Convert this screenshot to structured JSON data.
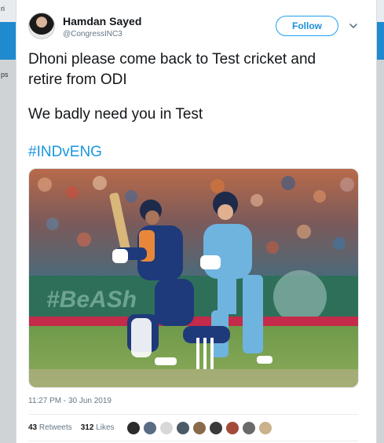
{
  "background": {
    "fragments": [
      "ri",
      "ps"
    ]
  },
  "tweet": {
    "author": {
      "display_name": "Hamdan Sayed",
      "handle": "@CongressINC3"
    },
    "follow_label": "Follow",
    "text_line1": "Dhoni please come back to Test cricket and",
    "text_line2": "retire from ODI",
    "text_line3": "We badly need you in Test",
    "hashtag": "#INDvENG",
    "image_overlay_text": "#BeASh",
    "timestamp": "11:27 PM - 30 Jun 2019",
    "retweets_count": "43",
    "retweets_label": "Retweets",
    "likes_count": "312",
    "likes_label": "Likes",
    "liker_avatars": [
      {
        "icon": "liker-avatar-icon",
        "color": "#2b2b2b"
      },
      {
        "icon": "liker-avatar-icon",
        "color": "#5a6c84"
      },
      {
        "icon": "liker-avatar-icon",
        "color": "#d8d8d8"
      },
      {
        "icon": "liker-avatar-icon",
        "color": "#4a5a66"
      },
      {
        "icon": "liker-avatar-icon",
        "color": "#8a6a4a"
      },
      {
        "icon": "liker-avatar-icon",
        "color": "#3a3a3a"
      },
      {
        "icon": "liker-avatar-icon",
        "color": "#a34a3a"
      },
      {
        "icon": "liker-avatar-icon",
        "color": "#6a6a6a"
      },
      {
        "icon": "liker-avatar-icon",
        "color": "#c9b28c"
      }
    ]
  },
  "colors": {
    "link_blue": "#1b95e0",
    "follow_border": "#1da1f2",
    "text_dark": "#14171a",
    "text_muted": "#657786"
  }
}
